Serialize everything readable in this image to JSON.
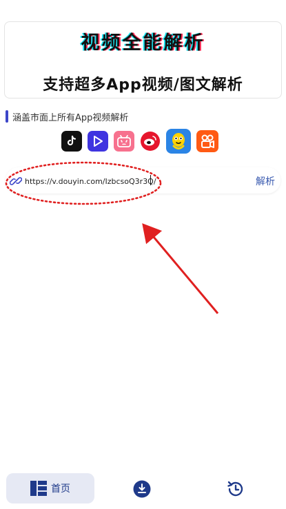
{
  "banner": {
    "title": "视频全能解析",
    "subtitle": "支持超多App视频/图文解析"
  },
  "section": {
    "label": "涵盖市面上所有App视频解析"
  },
  "apps": [
    {
      "name": "douyin-icon"
    },
    {
      "name": "video-play-icon"
    },
    {
      "name": "bilibili-icon"
    },
    {
      "name": "weibo-icon"
    },
    {
      "name": "qq-penguin-icon"
    },
    {
      "name": "kuaishou-icon"
    }
  ],
  "url_field": {
    "value": "https://v.douyin.com/IzbcsoQ3r3Q/",
    "parse_label": "解析"
  },
  "nav": {
    "home_label": "首页"
  },
  "colors": {
    "accent": "#3c46c8",
    "annotation": "#e02020",
    "nav_active_bg": "#e6e9f4"
  }
}
